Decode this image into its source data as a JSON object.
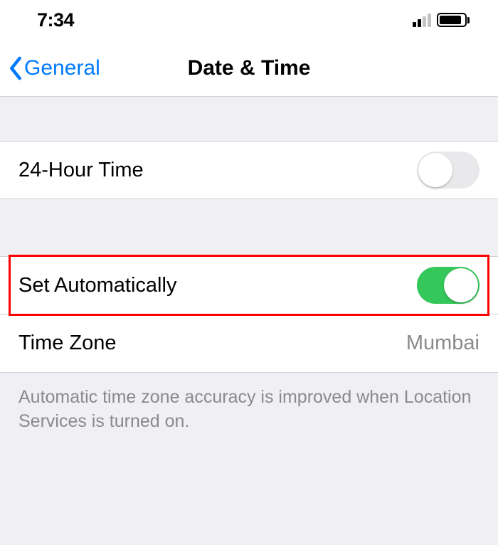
{
  "status": {
    "time": "7:34"
  },
  "nav": {
    "back_label": "General",
    "title": "Date & Time"
  },
  "rows": {
    "twentyfour": {
      "label": "24-Hour Time"
    },
    "auto": {
      "label": "Set Automatically"
    },
    "timezone": {
      "label": "Time Zone",
      "value": "Mumbai"
    }
  },
  "footer": "Automatic time zone accuracy is improved when Location Services is turned on."
}
